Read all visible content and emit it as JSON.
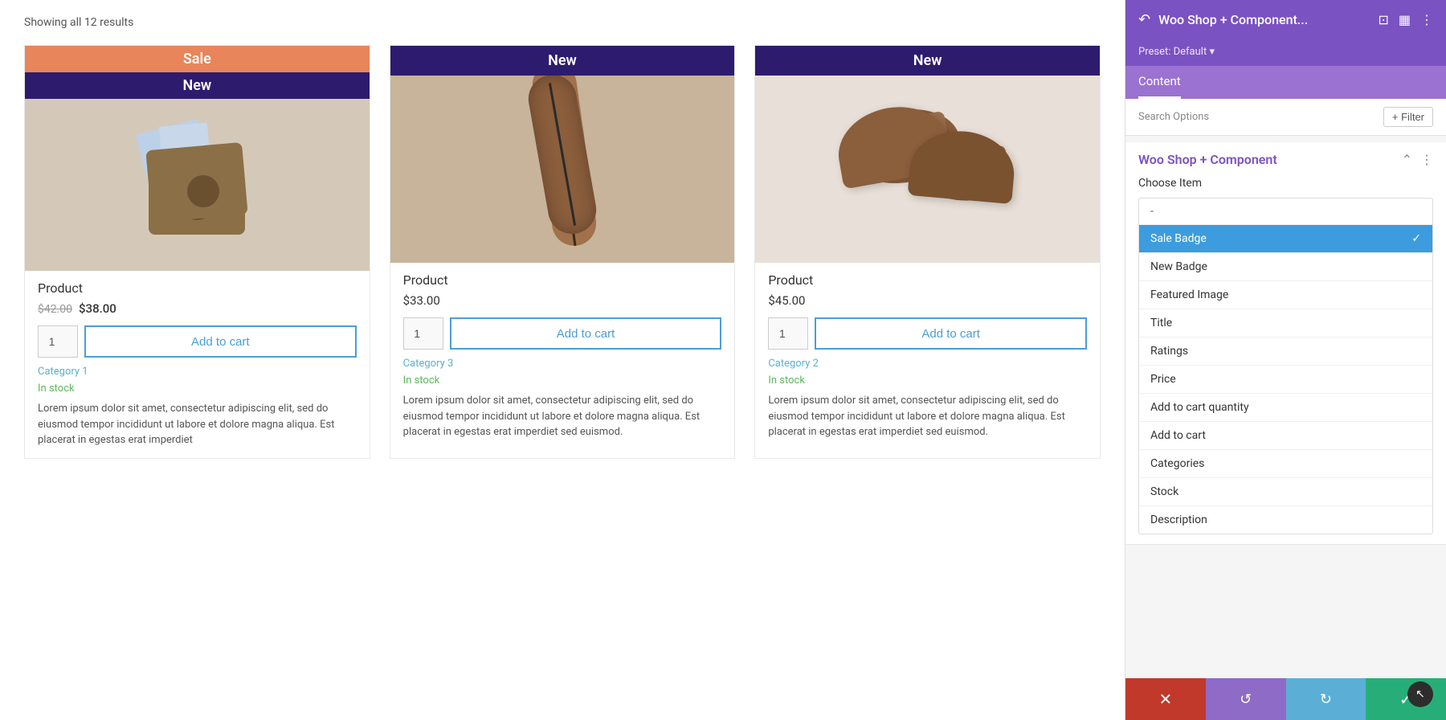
{
  "main": {
    "results_text": "Showing all 12 results"
  },
  "products": [
    {
      "id": "product-1",
      "badge_sale": "Sale",
      "badge_new": "New",
      "title": "Product",
      "price_original": "$42.00",
      "price_current": "$38.00",
      "qty": "1",
      "add_to_cart": "Add to cart",
      "category": "Category 1",
      "stock": "In stock",
      "description": "Lorem ipsum dolor sit amet, consectetur adipiscing elit, sed do eiusmod tempor incididunt ut labore et dolore magna aliqua. Est placerat in egestas erat imperdiet"
    },
    {
      "id": "product-2",
      "badge_new": "New",
      "title": "Product",
      "price": "$33.00",
      "qty": "1",
      "add_to_cart": "Add to cart",
      "category": "Category 3",
      "stock": "In stock",
      "description": "Lorem ipsum dolor sit amet, consectetur adipiscing elit, sed do eiusmod tempor incididunt ut labore et dolore magna aliqua. Est placerat in egestas erat imperdiet sed euismod."
    },
    {
      "id": "product-3",
      "badge_new": "New",
      "title": "Product",
      "price": "$45.00",
      "qty": "1",
      "add_to_cart": "Add to cart",
      "category": "Category 2",
      "stock": "In stock",
      "description": "Lorem ipsum dolor sit amet, consectetur adipiscing elit, sed do eiusmod tempor incididunt ut labore et dolore magna aliqua. Est placerat in egestas erat imperdiet sed euismod."
    }
  ],
  "panel": {
    "title": "Woo Shop + Component...",
    "preset_label": "Preset: Default",
    "content_tab": "Content",
    "search_options": "Search Options",
    "filter_btn": "Filter",
    "component_title": "Woo Shop + Component",
    "choose_item_label": "Choose Item",
    "dropdown_items": [
      {
        "id": "dash",
        "label": "-",
        "selected": false,
        "is_dash": true
      },
      {
        "id": "sale-badge",
        "label": "Sale Badge",
        "selected": true
      },
      {
        "id": "new-badge",
        "label": "New Badge",
        "selected": false
      },
      {
        "id": "featured-image",
        "label": "Featured Image",
        "selected": false
      },
      {
        "id": "title",
        "label": "Title",
        "selected": false
      },
      {
        "id": "ratings",
        "label": "Ratings",
        "selected": false
      },
      {
        "id": "price",
        "label": "Price",
        "selected": false
      },
      {
        "id": "add-to-cart-quantity",
        "label": "Add to cart quantity",
        "selected": false
      },
      {
        "id": "add-to-cart",
        "label": "Add to cart",
        "selected": false
      },
      {
        "id": "categories",
        "label": "Categories",
        "selected": false
      },
      {
        "id": "stock",
        "label": "Stock",
        "selected": false
      },
      {
        "id": "description",
        "label": "Description",
        "selected": false
      }
    ]
  },
  "bottom_bar": {
    "cancel_icon": "✕",
    "undo_icon": "↺",
    "redo_icon": "↻",
    "save_icon": "✓"
  }
}
